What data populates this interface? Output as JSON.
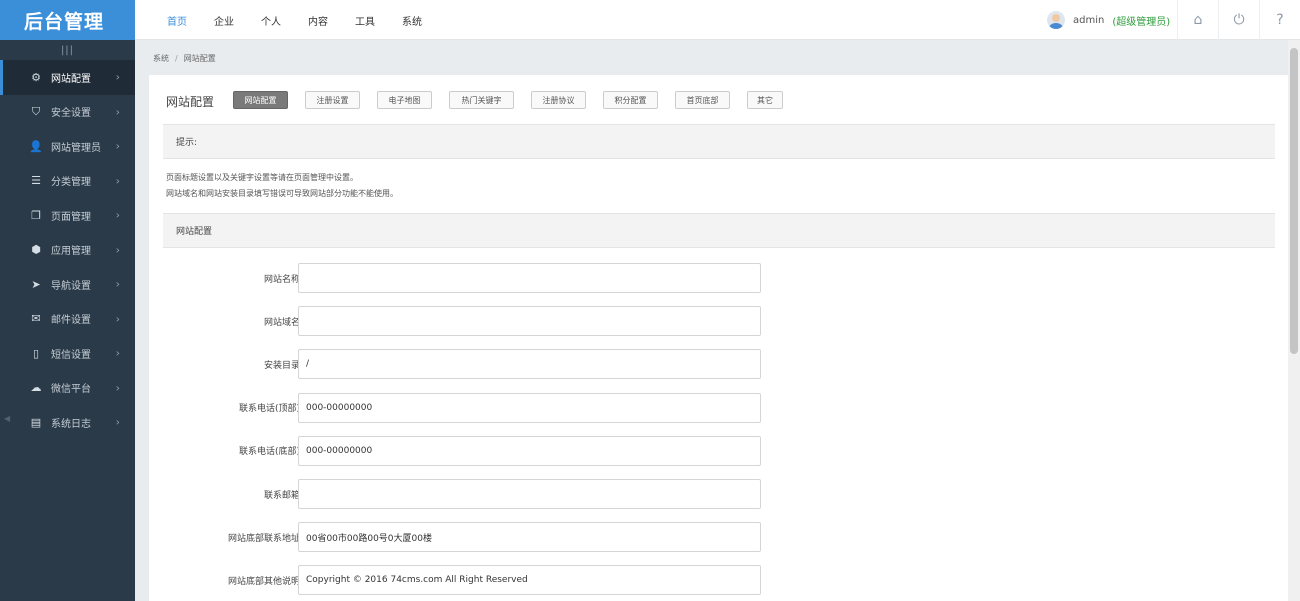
{
  "app": {
    "title": "后台管理"
  },
  "topnav": [
    {
      "label": "首页",
      "active": true
    },
    {
      "label": "企业",
      "active": false
    },
    {
      "label": "个人",
      "active": false
    },
    {
      "label": "内容",
      "active": false
    },
    {
      "label": "工具",
      "active": false
    },
    {
      "label": "系统",
      "active": false
    }
  ],
  "user": {
    "name": "admin",
    "role": "(超级管理员)"
  },
  "sidebar": {
    "collapse_glyph": "|||",
    "items": [
      {
        "label": "网站配置",
        "icon": "gear-icon",
        "glyph": "⚙",
        "active": true
      },
      {
        "label": "安全设置",
        "icon": "shield-icon",
        "glyph": "⛉",
        "active": false
      },
      {
        "label": "网站管理员",
        "icon": "user-icon",
        "glyph": "👤",
        "active": false
      },
      {
        "label": "分类管理",
        "icon": "list-icon",
        "glyph": "☰",
        "active": false
      },
      {
        "label": "页面管理",
        "icon": "pages-icon",
        "glyph": "❐",
        "active": false
      },
      {
        "label": "应用管理",
        "icon": "cube-icon",
        "glyph": "⬢",
        "active": false
      },
      {
        "label": "导航设置",
        "icon": "navigation-icon",
        "glyph": "➤",
        "active": false
      },
      {
        "label": "邮件设置",
        "icon": "mail-icon",
        "glyph": "✉",
        "active": false
      },
      {
        "label": "短信设置",
        "icon": "phone-icon",
        "glyph": "▯",
        "active": false
      },
      {
        "label": "微信平台",
        "icon": "wechat-icon",
        "glyph": "☁",
        "active": false
      },
      {
        "label": "系统日志",
        "icon": "log-icon",
        "glyph": "▤",
        "active": false
      }
    ]
  },
  "breadcrumb": [
    "系统",
    "网站配置"
  ],
  "breadcrumb_sep": "/",
  "page": {
    "title": "网站配置",
    "tabs": [
      {
        "label": "网站配置",
        "active": true
      },
      {
        "label": "注册设置",
        "active": false
      },
      {
        "label": "电子地图",
        "active": false
      },
      {
        "label": "热门关键字",
        "active": false
      },
      {
        "label": "注册协议",
        "active": false
      },
      {
        "label": "积分配置",
        "active": false
      },
      {
        "label": "首页底部",
        "active": false
      },
      {
        "label": "其它",
        "active": false
      }
    ],
    "tips_title": "提示:",
    "tips": [
      "页面标题设置以及关键字设置等请在页面管理中设置。",
      "网站域名和网站安装目录填写错误可导致网站部分功能不能使用。"
    ],
    "form_title": "网站配置",
    "fields": [
      {
        "label": "网站名称:",
        "value": ""
      },
      {
        "label": "网站域名:",
        "value": ""
      },
      {
        "label": "安装目录:",
        "value": "/"
      },
      {
        "label": "联系电话(顶部):",
        "value": "000-00000000"
      },
      {
        "label": "联系电话(底部):",
        "value": "000-00000000"
      },
      {
        "label": "联系邮箱:",
        "value": ""
      },
      {
        "label": "网站底部联系地址:",
        "value": "00省00市00路00号0大厦00楼"
      },
      {
        "label": "网站底部其他说明:",
        "value": "Copyright © 2016 74cms.com All Right Reserved"
      }
    ]
  },
  "top_icons": [
    {
      "name": "home-icon",
      "glyph": "⌂"
    },
    {
      "name": "power-icon",
      "glyph": "⏻"
    },
    {
      "name": "help-icon",
      "glyph": "?"
    }
  ]
}
